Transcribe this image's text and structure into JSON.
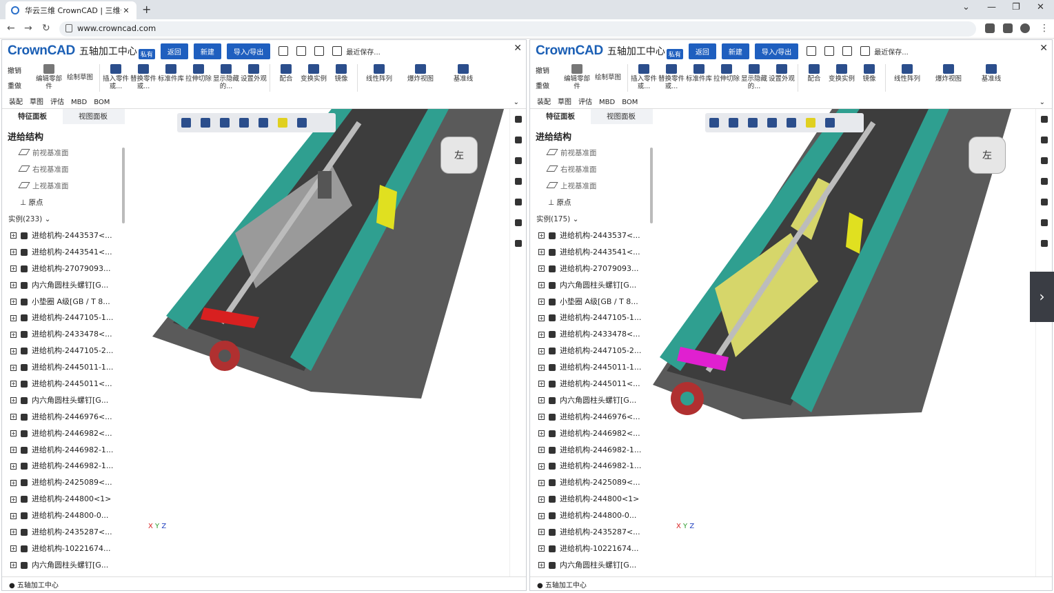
{
  "browser": {
    "tab_title": "华云三维 CrownCAD | 三维云C/",
    "url": "www.crowncad.com"
  },
  "app": {
    "logo": "CrownCAD",
    "project": "五轴加工中心",
    "badge": "私有",
    "back": "返回",
    "new": "新建",
    "import_export": "导入/导出",
    "recent_save": "最近保存..."
  },
  "ribbon": {
    "undo": "撤销",
    "redo": "重做",
    "edit_part": "编辑零部件",
    "sketch": "绘制草图",
    "insert_part": "插入零件或...",
    "replace_part": "替换零件或...",
    "std_lib": "标准件库",
    "extrude_cut": "拉伸切除",
    "show_hide": "显示隐藏的...",
    "appearance": "设置外观",
    "mate": "配合",
    "transform": "变换实例",
    "mirror": "镜像",
    "linear_pattern": "线性阵列",
    "explode": "爆炸视图",
    "datum": "基准线"
  },
  "menus": [
    "装配",
    "草图",
    "评估",
    "MBD",
    "BOM"
  ],
  "panel_tabs": [
    "特征面板",
    "视图面板"
  ],
  "tree_root": "进给结构",
  "refs": [
    "前视基准面",
    "右视基准面",
    "上视基准面",
    "原点"
  ],
  "left": {
    "instances": "实例(233)",
    "status": "五轴加工中心"
  },
  "right": {
    "instances": "实例(175)",
    "status": "五轴加工中心"
  },
  "items": [
    "进给机构-2443537<...",
    "进给机构-2443541<...",
    "进给机构-27079093...",
    "内六角圆柱头螺钉[G...",
    "小垫圈 A级[GB / T 8...",
    "进给机构-2447105-1...",
    "进给机构-2433478<...",
    "进给机构-2447105-2...",
    "进给机构-2445011-1...",
    "进给机构-2445011<...",
    "内六角圆柱头螺钉[G...",
    "进给机构-2446976<...",
    "进给机构-2446982<...",
    "进给机构-2446982-1...",
    "进给机构-2446982-1...",
    "进给机构-2425089<...",
    "进给机构-244800<1>",
    "进给机构-244800-0...",
    "进给机构-2435287<...",
    "进给机构-10221674...",
    "内六角圆柱头螺钉[G..."
  ],
  "viewcube_face": "左",
  "axis_labels": {
    "x": "X",
    "y": "Y",
    "z": "Z"
  },
  "colors": {
    "brand": "#1f5fbf",
    "rail": "#2f9f90",
    "highlight_red": "#d82020",
    "highlight_yellow": "#d6d66a",
    "highlight_magenta": "#e020d0"
  }
}
